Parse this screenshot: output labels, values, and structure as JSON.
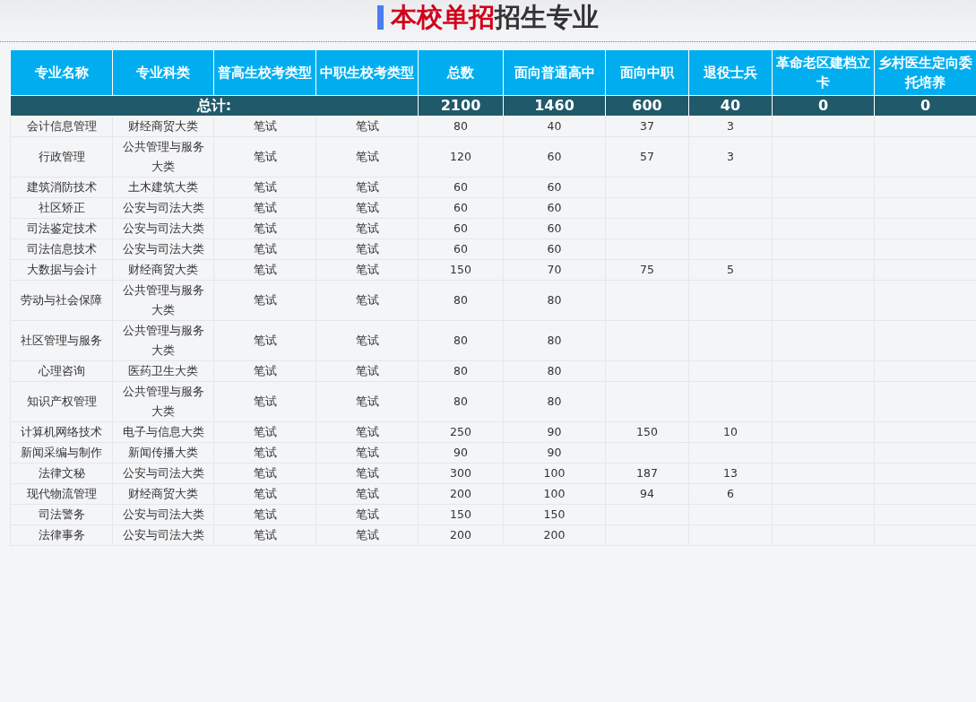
{
  "title": {
    "highlight": "本校单招",
    "rest": "招生专业"
  },
  "table": {
    "columns": [
      "专业名称",
      "专业科类",
      "普高生校考类型",
      "中职生校考类型",
      "总数",
      "面向普通高中",
      "面向中职",
      "退役士兵",
      "革命老区建档立卡",
      "乡村医生定向委托培养"
    ],
    "total": {
      "label": "总计:",
      "values": [
        "2100",
        "1460",
        "600",
        "40",
        "0",
        "0"
      ]
    },
    "rows": [
      [
        "会计信息管理",
        "财经商贸大类",
        "笔试",
        "笔试",
        "80",
        "40",
        "37",
        "3"
      ],
      [
        "行政管理",
        "公共管理与服务大类",
        "笔试",
        "笔试",
        "120",
        "60",
        "57",
        "3"
      ],
      [
        "建筑消防技术",
        "土木建筑大类",
        "笔试",
        "笔试",
        "60",
        "60"
      ],
      [
        "社区矫正",
        "公安与司法大类",
        "笔试",
        "笔试",
        "60",
        "60"
      ],
      [
        "司法鉴定技术",
        "公安与司法大类",
        "笔试",
        "笔试",
        "60",
        "60"
      ],
      [
        "司法信息技术",
        "公安与司法大类",
        "笔试",
        "笔试",
        "60",
        "60"
      ],
      [
        "大数据与会计",
        "财经商贸大类",
        "笔试",
        "笔试",
        "150",
        "70",
        "75",
        "5"
      ],
      [
        "劳动与社会保障",
        "公共管理与服务大类",
        "笔试",
        "笔试",
        "80",
        "80"
      ],
      [
        "社区管理与服务",
        "公共管理与服务大类",
        "笔试",
        "笔试",
        "80",
        "80"
      ],
      [
        "心理咨询",
        "医药卫生大类",
        "笔试",
        "笔试",
        "80",
        "80"
      ],
      [
        "知识产权管理",
        "公共管理与服务大类",
        "笔试",
        "笔试",
        "80",
        "80"
      ],
      [
        "计算机网络技术",
        "电子与信息大类",
        "笔试",
        "笔试",
        "250",
        "90",
        "150",
        "10"
      ],
      [
        "新闻采编与制作",
        "新闻传播大类",
        "笔试",
        "笔试",
        "90",
        "90"
      ],
      [
        "法律文秘",
        "公安与司法大类",
        "笔试",
        "笔试",
        "300",
        "100",
        "187",
        "13"
      ],
      [
        "现代物流管理",
        "财经商贸大类",
        "笔试",
        "笔试",
        "200",
        "100",
        "94",
        "6"
      ],
      [
        "司法警务",
        "公安与司法大类",
        "笔试",
        "笔试",
        "150",
        "150"
      ],
      [
        "法律事务",
        "公安与司法大类",
        "笔试",
        "笔试",
        "200",
        "200"
      ]
    ]
  }
}
